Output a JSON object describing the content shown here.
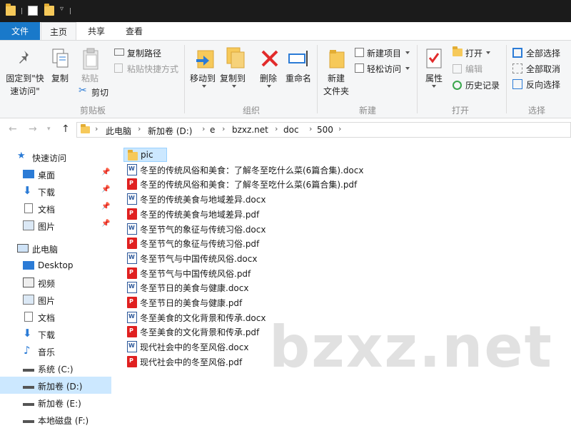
{
  "ribbon_tabs": [
    {
      "label": "文件"
    },
    {
      "label": "主页"
    },
    {
      "label": "共享"
    },
    {
      "label": "查看"
    }
  ],
  "ribbon": {
    "clipboard": {
      "pin_label_1": "固定到\"快",
      "pin_label_2": "速访问\"",
      "copy": "复制",
      "paste": "粘贴",
      "copy_path": "复制路径",
      "paste_shortcut": "粘贴快捷方式",
      "cut": "剪切",
      "group": "剪贴板"
    },
    "organize": {
      "move_to": "移动到",
      "copy_to": "复制到",
      "delete": "删除",
      "rename": "重命名",
      "group": "组织"
    },
    "new": {
      "new_folder_1": "新建",
      "new_folder_2": "文件夹",
      "new_item": "新建项目",
      "easy_access": "轻松访问",
      "group": "新建"
    },
    "open": {
      "properties": "属性",
      "open": "打开",
      "edit": "编辑",
      "history": "历史记录",
      "group": "打开"
    },
    "select": {
      "select_all": "全部选择",
      "select_none": "全部取消",
      "invert": "反向选择",
      "group": "选择"
    }
  },
  "address": {
    "crumbs": [
      "此电脑",
      "新加卷 (D:)",
      "e",
      "bzxz.net",
      "doc",
      "500"
    ]
  },
  "nav": {
    "quick_access": "快速访问",
    "quick_items": [
      "桌面",
      "下载",
      "文档",
      "图片"
    ],
    "this_pc": "此电脑",
    "pc_items": [
      "Desktop",
      "视频",
      "图片",
      "文档",
      "下载",
      "音乐",
      "系统 (C:)",
      "新加卷 (D:)",
      "新加卷 (E:)",
      "本地磁盘 (F:)"
    ]
  },
  "files": [
    {
      "name": "pic",
      "type": "folder"
    },
    {
      "name": "冬至的传统风俗和美食：了解冬至吃什么菜(6篇合集).docx",
      "type": "docx"
    },
    {
      "name": "冬至的传统风俗和美食：了解冬至吃什么菜(6篇合集).pdf",
      "type": "pdf"
    },
    {
      "name": "冬至的传统美食与地域差异.docx",
      "type": "docx"
    },
    {
      "name": "冬至的传统美食与地域差异.pdf",
      "type": "pdf"
    },
    {
      "name": "冬至节气的象征与传统习俗.docx",
      "type": "docx"
    },
    {
      "name": "冬至节气的象征与传统习俗.pdf",
      "type": "pdf"
    },
    {
      "name": "冬至节气与中国传统风俗.docx",
      "type": "docx"
    },
    {
      "name": "冬至节气与中国传统风俗.pdf",
      "type": "pdf"
    },
    {
      "name": "冬至节日的美食与健康.docx",
      "type": "docx"
    },
    {
      "name": "冬至节日的美食与健康.pdf",
      "type": "pdf"
    },
    {
      "name": "冬至美食的文化背景和传承.docx",
      "type": "docx"
    },
    {
      "name": "冬至美食的文化背景和传承.pdf",
      "type": "pdf"
    },
    {
      "name": "现代社会中的冬至风俗.docx",
      "type": "docx"
    },
    {
      "name": "现代社会中的冬至风俗.pdf",
      "type": "pdf"
    }
  ],
  "watermark": "bzxz.net"
}
